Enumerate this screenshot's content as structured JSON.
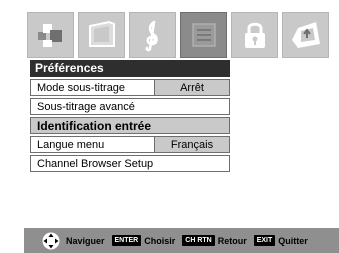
{
  "tabs": [
    {
      "icon": "picture-icon",
      "active": false
    },
    {
      "icon": "screen-shape-icon",
      "active": false
    },
    {
      "icon": "audio-clef-icon",
      "active": false
    },
    {
      "icon": "preferences-icon",
      "active": true
    },
    {
      "icon": "lock-icon",
      "active": false
    },
    {
      "icon": "setup-icon",
      "active": false
    }
  ],
  "menu": {
    "title": "Préférences",
    "items": [
      {
        "label": "Mode sous-titrage",
        "value": "Arrêt"
      },
      {
        "label": "Sous-titrage avancé"
      },
      {
        "label": "Identification entrée",
        "highlight": true
      },
      {
        "label": "Langue menu",
        "value": "Français"
      },
      {
        "label": "Channel Browser Setup"
      }
    ]
  },
  "statusbar": {
    "navigate": "Naviguer",
    "enter_key": "ENTER",
    "enter_label": "Choisir",
    "rtn_key": "CH RTN",
    "rtn_label": "Retour",
    "exit_key": "EXIT",
    "exit_label": "Quitter"
  },
  "colors": {
    "tab_bg": "#c9c9c9",
    "tab_active_bg": "#8b8b8b",
    "title_bar": "#2e2e2e",
    "highlight_row": "#c9c9c9",
    "statusbar_bg": "#8f8f8f"
  }
}
